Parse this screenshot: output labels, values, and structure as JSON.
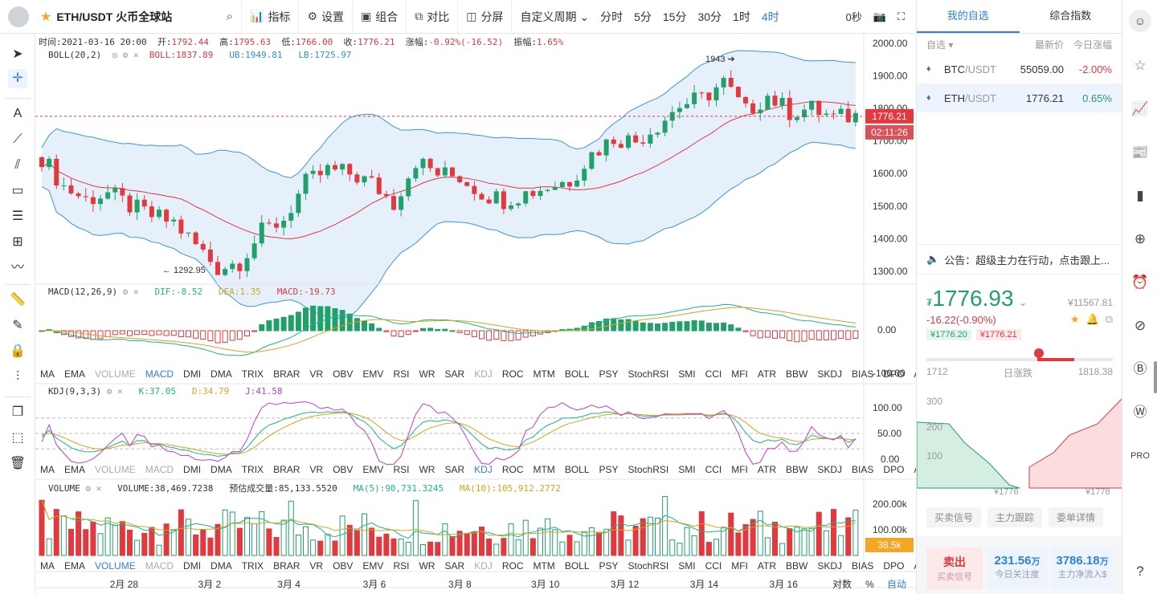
{
  "header": {
    "pair_title": "ETH/USDT 火币全球站",
    "tools": [
      {
        "icon": "chart-indicator-icon",
        "label": "指标"
      },
      {
        "icon": "gear-icon",
        "label": "设置"
      },
      {
        "icon": "combo-icon",
        "label": "组合"
      },
      {
        "icon": "compare-icon",
        "label": "对比"
      },
      {
        "icon": "split-screen-icon",
        "label": "分屏"
      }
    ],
    "period_custom": "自定义周期",
    "periods": [
      "分时",
      "5分",
      "15分",
      "30分",
      "1时",
      "4时"
    ],
    "active_period": "4时",
    "countdown": "0秒"
  },
  "info_line": {
    "time_label": "时间:",
    "time": "2021-03-16 20:00",
    "open_label": "开:",
    "open": "1792.44",
    "high_label": "高:",
    "high": "1795.63",
    "low_label": "低:",
    "low": "1766.00",
    "close_label": "收:",
    "close": "1776.21",
    "change_label": "涨幅:",
    "change": "-0.92%(-16.52)",
    "amp_label": "振幅:",
    "amp": "1.65%"
  },
  "boll": {
    "name": "BOLL(20,2)",
    "boll": "BOLL:1837.89",
    "ub": "UB:1949.81",
    "lb": "LB:1725.97"
  },
  "macd": {
    "name": "MACD(12,26,9)",
    "dif": "DIF:-8.52",
    "dea": "DEA:1.35",
    "macd": "MACD:-19.73"
  },
  "kdj": {
    "name": "KDJ(9,3,3)",
    "k": "K:37.05",
    "d": "D:34.79",
    "j": "J:41.58"
  },
  "volume": {
    "name": "VOLUME",
    "vol": "VOLUME:38,469.7238",
    "est": "预估成交量:85,133.5520",
    "ma5": "MA(5):90,731.3245",
    "ma10": "MA(10):105,912.2772"
  },
  "indicator_tabs": [
    "MA",
    "EMA",
    "VOLUME",
    "MACD",
    "DMI",
    "DMA",
    "TRIX",
    "BRAR",
    "VR",
    "OBV",
    "EMV",
    "RSI",
    "WR",
    "SAR",
    "KDJ",
    "ROC",
    "MTM",
    "BOLL",
    "PSY",
    "StochRSI",
    "SMI",
    "CCI",
    "MFI",
    "ATR",
    "BBW",
    "SKDJ",
    "BIAS",
    "DPO",
    "AO"
  ],
  "price_axis": [
    "2000.00",
    "1900.00",
    "1800.00",
    "1700.00",
    "1600.00",
    "1500.00",
    "1400.00",
    "1300.00"
  ],
  "current_price_tag": "1776.21",
  "countdown_tag": "02:11:26",
  "macd_axis": [
    "0.00",
    "-100.00"
  ],
  "kdj_axis": [
    "100.00",
    "50.00",
    "0.00"
  ],
  "vol_axis": [
    "200.00k",
    "100.00k"
  ],
  "vol_tag": "38.5k",
  "high_mark": "1943",
  "low_mark": "1292.95",
  "date_axis": [
    "2月 28",
    "3月 2",
    "3月 4",
    "3月 6",
    "3月 8",
    "3月 10",
    "3月 12",
    "3月 14",
    "3月 16"
  ],
  "footer_right": {
    "contract": "对数",
    "percent": "%",
    "auto": "自动"
  },
  "sidebar": {
    "tabs": [
      "我的自选",
      "综合指数"
    ],
    "watch_header": {
      "name": "自选",
      "price": "最新价",
      "change": "今日涨幅"
    },
    "watchlist": [
      {
        "base": "BTC",
        "quote": "/USDT",
        "price": "55059.00",
        "change": "-2.00%",
        "dir": "down"
      },
      {
        "base": "ETH",
        "quote": "/USDT",
        "price": "1776.21",
        "change": "0.65%",
        "dir": "up"
      }
    ],
    "notice": "公告：超级主力在行动，点击跟上...",
    "big_price": "1776.93",
    "cny": "¥11567.81",
    "change": "-16.22(-0.90%)",
    "bid_tag": "¥1776.20",
    "ask_tag": "¥1776.21",
    "range_low": "1712",
    "range_label": "日涨跌",
    "range_high": "1818.38",
    "depth_axis": [
      "300",
      "200",
      "100"
    ],
    "depth_low_label": "¥1776",
    "depth_high_label": "¥1778",
    "buttons": [
      "买卖信号",
      "主力跟踪",
      "委单详情"
    ],
    "sell_label": "卖出",
    "sell_sub": "买卖信号",
    "attention_value": "231.56",
    "attention_unit": "万",
    "attention_label": "今日关注度",
    "inflow_value": "3786.18",
    "inflow_unit": "万",
    "inflow_label": "主力净流入$"
  },
  "colors": {
    "up": "#22a06b",
    "down": "#e0393e",
    "accent": "#2f7ee0"
  }
}
